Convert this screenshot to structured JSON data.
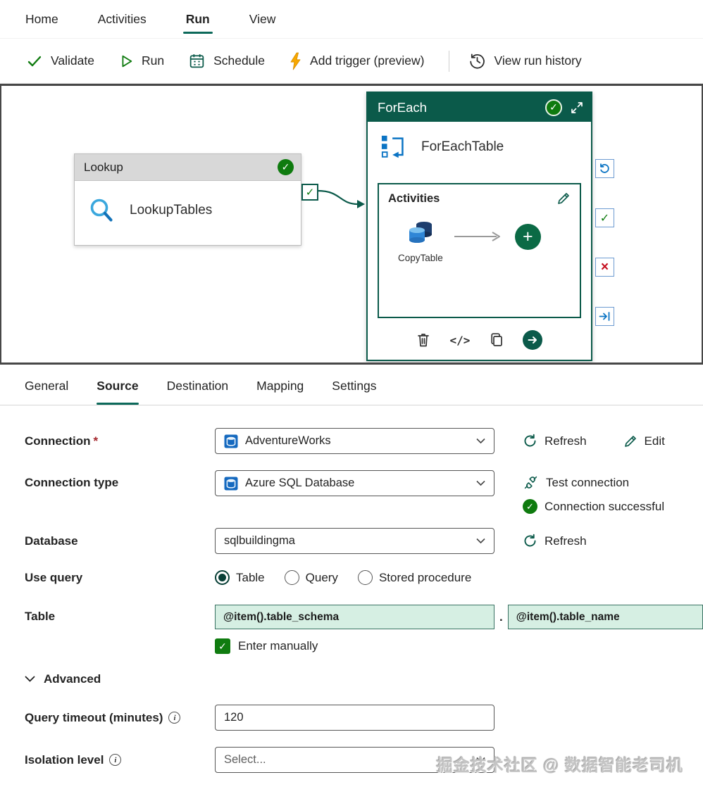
{
  "menubar": {
    "items": [
      {
        "label": "Home"
      },
      {
        "label": "Activities"
      },
      {
        "label": "Run"
      },
      {
        "label": "View"
      }
    ]
  },
  "toolbar": {
    "validate": "Validate",
    "run": "Run",
    "schedule": "Schedule",
    "add_trigger": "Add trigger (preview)",
    "view_run_history": "View run history"
  },
  "canvas": {
    "lookup": {
      "header": "Lookup",
      "name": "LookupTables"
    },
    "foreach": {
      "header": "ForEach",
      "name": "ForEachTable",
      "activities_title": "Activities",
      "inner_activity": "CopyTable"
    }
  },
  "tabs": {
    "items": [
      "General",
      "Source",
      "Destination",
      "Mapping",
      "Settings"
    ],
    "active": "Source"
  },
  "form": {
    "connection": {
      "label": "Connection",
      "required": "*",
      "value": "AdventureWorks",
      "refresh": "Refresh",
      "edit": "Edit"
    },
    "connection_type": {
      "label": "Connection type",
      "value": "Azure SQL Database",
      "test": "Test connection",
      "success": "Connection successful"
    },
    "database": {
      "label": "Database",
      "value": "sqlbuildingma",
      "refresh": "Refresh"
    },
    "use_query": {
      "label": "Use query",
      "options": [
        "Table",
        "Query",
        "Stored procedure"
      ],
      "selected": "Table"
    },
    "table": {
      "label": "Table",
      "schema_value": "@item().table_schema",
      "separator": ".",
      "name_value": "@item().table_name",
      "enter_manually": "Enter manually",
      "enter_manually_checked": true
    },
    "advanced": {
      "label": "Advanced"
    },
    "query_timeout": {
      "label": "Query timeout (minutes)",
      "value": "120"
    },
    "isolation": {
      "label": "Isolation level",
      "placeholder": "Select..."
    }
  },
  "icons": {
    "check": "✓",
    "cross": "×",
    "plus": "+",
    "code": "</>"
  },
  "colors": {
    "accent": "#0c695a",
    "foreach_header": "#0b5a4a",
    "success_green": "#0f7b0f",
    "error_red": "#c50f1f",
    "blue": "#0b74c4"
  },
  "watermark": "掘金技术社区 @ 数据智能老司机"
}
